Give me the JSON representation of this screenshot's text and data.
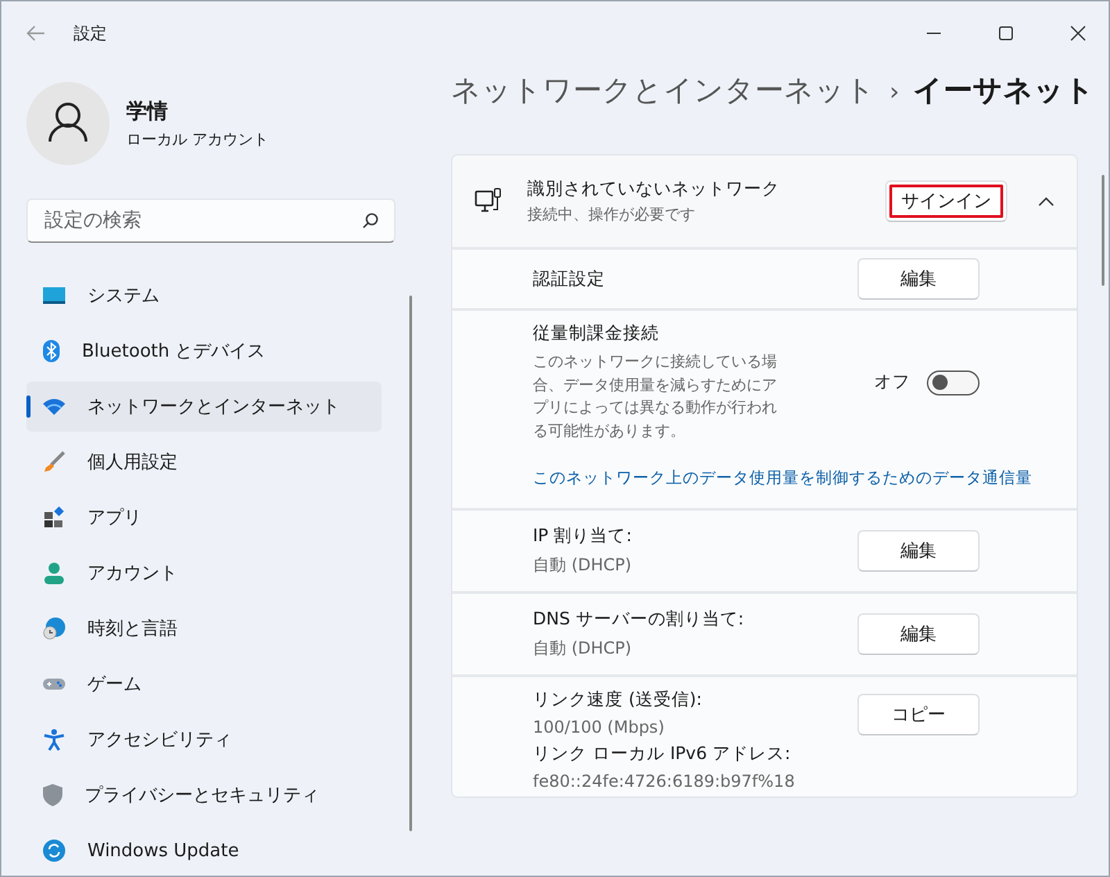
{
  "window": {
    "title": "設定"
  },
  "profile": {
    "name": "学情",
    "account_type": "ローカル アカウント"
  },
  "search": {
    "placeholder": "設定の検索"
  },
  "sidebar": {
    "items": [
      {
        "label": "システム",
        "kind": "system",
        "selected": false
      },
      {
        "label": "Bluetooth とデバイス",
        "kind": "bluetooth",
        "selected": false
      },
      {
        "label": "ネットワークとインターネット",
        "kind": "network",
        "selected": true
      },
      {
        "label": "個人用設定",
        "kind": "brush",
        "selected": false
      },
      {
        "label": "アプリ",
        "kind": "apps",
        "selected": false
      },
      {
        "label": "アカウント",
        "kind": "account",
        "selected": false
      },
      {
        "label": "時刻と言語",
        "kind": "time",
        "selected": false
      },
      {
        "label": "ゲーム",
        "kind": "game",
        "selected": false
      },
      {
        "label": "アクセシビリティ",
        "kind": "accessibility",
        "selected": false
      },
      {
        "label": "プライバシーとセキュリティ",
        "kind": "shield",
        "selected": false
      },
      {
        "label": "Windows Update",
        "kind": "update",
        "selected": false
      }
    ]
  },
  "breadcrumb": {
    "parent": "ネットワークとインターネット",
    "separator": "›",
    "current": "イーサネット"
  },
  "network": {
    "name": "識別されていないネットワーク",
    "status": "接続中、操作が必要です",
    "button": "サインイン",
    "button_highlighted": true,
    "expanded": true
  },
  "rows": [
    {
      "kind": "button",
      "label": "認証設定",
      "button": "編集"
    },
    {
      "kind": "toggle",
      "label": "従量制課金接続",
      "description": "このネットワークに接続している場合、データ使用量を減らすためにアプリによっては異なる動作が行われる可能性があります。",
      "state_text": "オフ",
      "on": false,
      "link": "このネットワーク上のデータ使用量を制御するためのデータ通信量"
    },
    {
      "kind": "value",
      "label": "IP 割り当て:",
      "value": "自動 (DHCP)",
      "button": "編集"
    },
    {
      "kind": "value",
      "label": "DNS サーバーの割り当て:",
      "value": "自動 (DHCP)",
      "button": "編集"
    },
    {
      "kind": "properties",
      "button": "コピー",
      "items": [
        {
          "label": "リンク速度 (送受信):",
          "value": "100/100 (Mbps)"
        },
        {
          "label": "リンク ローカル IPv6 アドレス:",
          "value": "fe80::24fe:4726:6189:b97f%18"
        }
      ]
    }
  ]
}
